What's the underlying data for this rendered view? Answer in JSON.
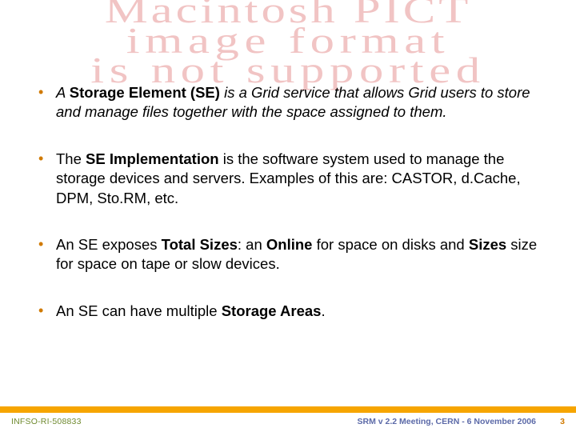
{
  "watermark": {
    "line1": "Macintosh PICT",
    "line2": "image format",
    "line3": "is not supported"
  },
  "bullets": [
    {
      "prefix": "A ",
      "bold1": "Storage Element (SE)",
      "rest": " is a Grid service that allows Grid users to store and manage files together with the space assigned to them.",
      "italic": true
    },
    {
      "prefix": "The ",
      "bold1": "SE Implementation",
      "rest": " is the software system used to manage the storage devices and servers. Examples of this are: CASTOR, d.Cache, DPM, Sto.RM, etc."
    },
    {
      "prefix": "An SE exposes ",
      "bold1": "Total Sizes",
      "mid1": ": an ",
      "bold2": "Online",
      "mid2": " for space on disks and ",
      "bold3": "Sizes",
      "rest": " size for space on tape or slow devices."
    },
    {
      "prefix": "An SE can have multiple ",
      "bold1": "Storage Areas",
      "rest": "."
    }
  ],
  "footer": {
    "left": "INFSO-RI-508833",
    "center": "SRM v 2.2 Meeting, CERN - 6 November 2006",
    "right": "3"
  }
}
